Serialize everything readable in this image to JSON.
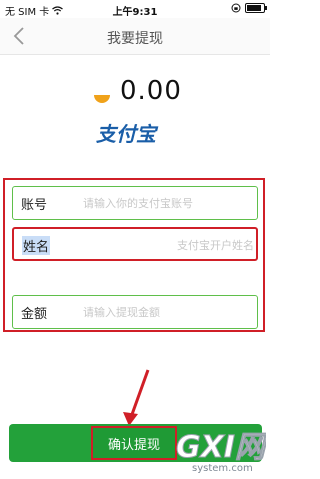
{
  "status_bar": {
    "carrier": "无 SIM 卡",
    "time": "上午9:31",
    "battery_level": 0.85
  },
  "nav": {
    "title": "我要提现"
  },
  "balance": {
    "amount": "0.00",
    "brand_logo_text": "支付宝"
  },
  "form": {
    "account": {
      "label": "账号",
      "placeholder": "请输入你的支付宝账号"
    },
    "name": {
      "label": "姓名",
      "placeholder": "支付宝开户姓名"
    },
    "amount": {
      "label": "金额",
      "placeholder": "请输入提现金额"
    }
  },
  "confirm": {
    "label": "确认提现"
  },
  "watermark": {
    "text": "GXI网",
    "domain": "system.com"
  },
  "colors": {
    "accent_green": "#23a13a",
    "annotation_red": "#d01f27",
    "field_border_green": "#5fbf4a",
    "alipay_blue": "#1a5ea8"
  },
  "icons": {
    "back": "chevron-left-icon",
    "wifi": "wifi-icon",
    "lock": "orientation-lock-icon",
    "battery": "battery-icon",
    "coin": "coin-icon",
    "arrow": "annotation-arrow-icon"
  }
}
